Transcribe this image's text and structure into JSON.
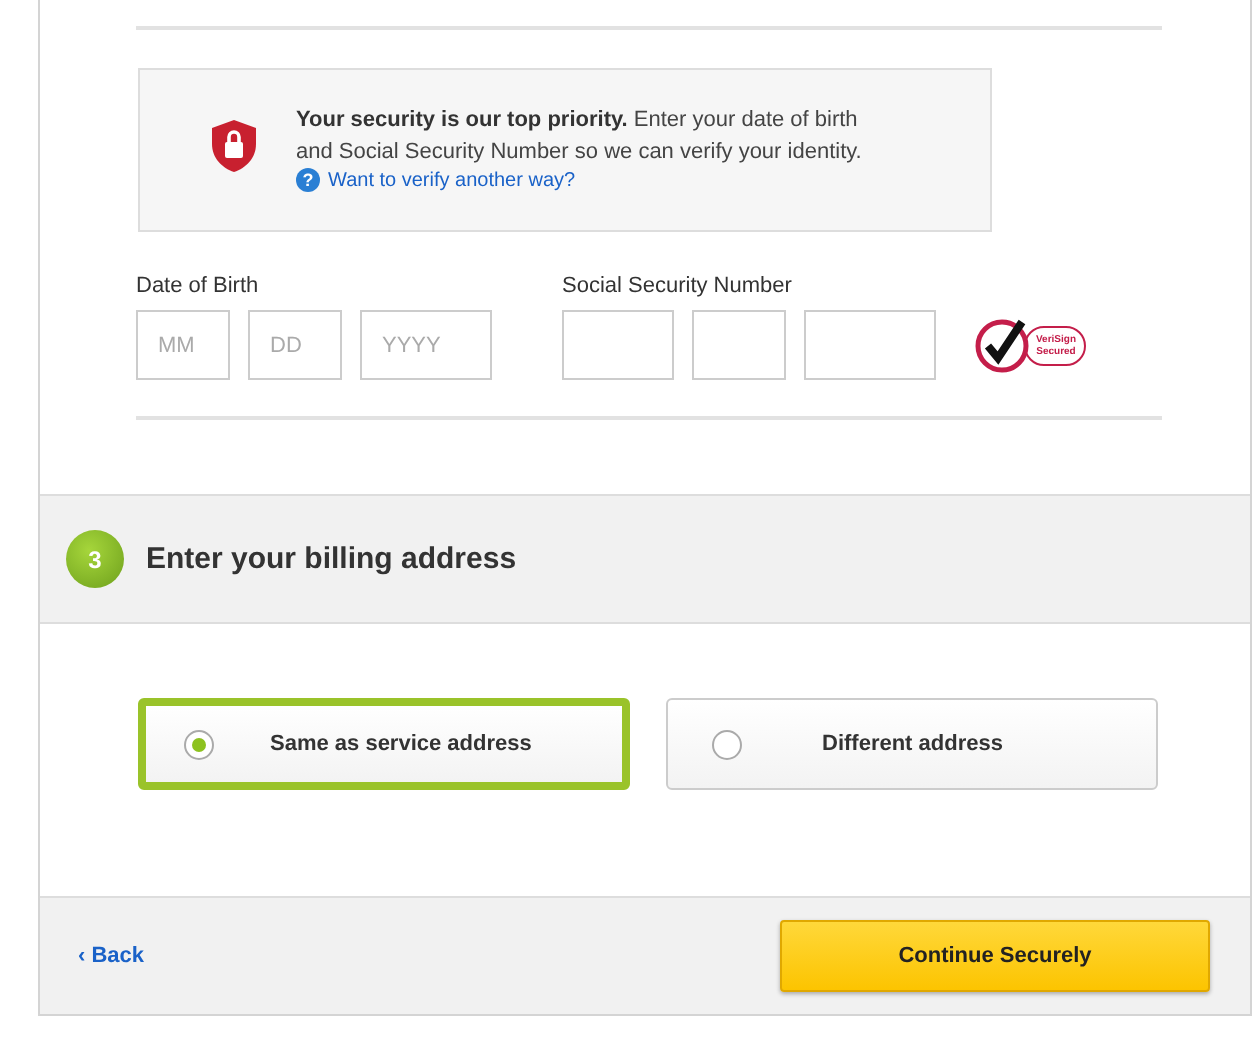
{
  "security_notice": {
    "text": "**Your security is our top priority.** Enter your date of birth and Social Security Number so we can verify your identity.",
    "help_link": "Want to verify another way?",
    "help_icon": "?"
  },
  "date_of_birth": {
    "label": "Date of Birth",
    "fields": [
      {
        "placeholder": "MM"
      },
      {
        "placeholder": "DD"
      },
      {
        "placeholder": "YYYY"
      }
    ]
  },
  "ssn": {
    "label": "Social Security Number"
  },
  "seal": {
    "text": "VeriSign Secured"
  },
  "section": {
    "step": "3",
    "title": "Enter your billing address"
  },
  "options": [
    {
      "label": "Same as service address",
      "selected": true
    },
    {
      "label": "Different address",
      "selected": false
    }
  ],
  "footer": {
    "back": "‹ Back",
    "continue": "Continue Securely"
  }
}
